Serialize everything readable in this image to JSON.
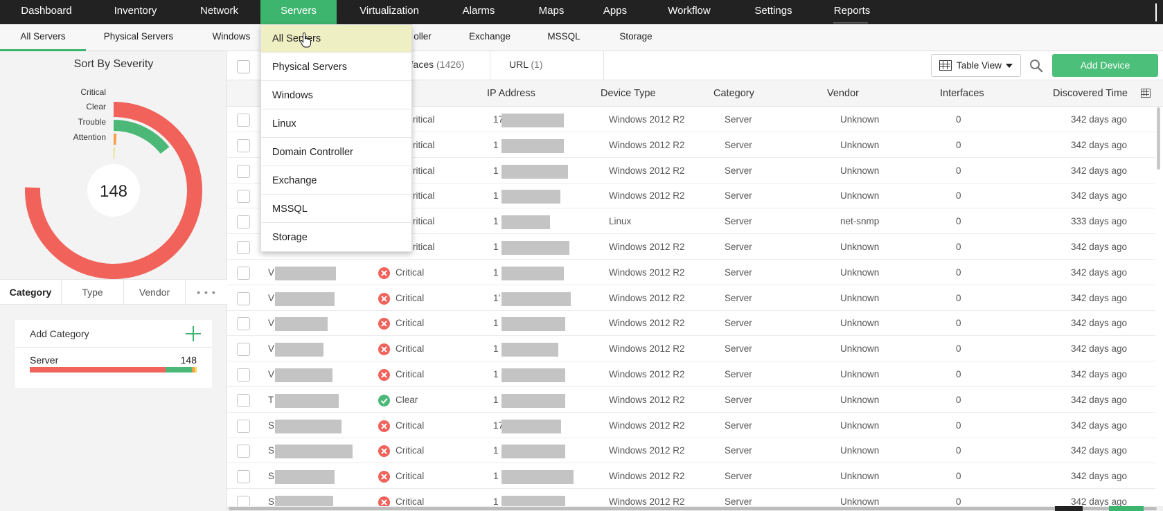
{
  "topnav": {
    "items": [
      {
        "label": "Dashboard"
      },
      {
        "label": "Inventory"
      },
      {
        "label": "Network"
      },
      {
        "label": "Servers"
      },
      {
        "label": "Virtualization"
      },
      {
        "label": "Alarms"
      },
      {
        "label": "Maps"
      },
      {
        "label": "Apps"
      },
      {
        "label": "Workflow"
      },
      {
        "label": "Settings"
      },
      {
        "label": "Reports"
      }
    ],
    "active": "Servers"
  },
  "subnav": {
    "items": [
      {
        "label": "All Servers"
      },
      {
        "label": "Physical Servers"
      },
      {
        "label": "Windows"
      },
      {
        "label": "oller"
      },
      {
        "label": "Exchange"
      },
      {
        "label": "MSSQL"
      },
      {
        "label": "Storage"
      }
    ],
    "active": "All Servers"
  },
  "dropdown": {
    "items": [
      {
        "label": "All Servers"
      },
      {
        "label": "Physical Servers"
      },
      {
        "label": "Windows"
      },
      {
        "label": "Linux"
      },
      {
        "label": "Domain Controller"
      },
      {
        "label": "Exchange"
      },
      {
        "label": "MSSQL"
      },
      {
        "label": "Storage"
      }
    ],
    "highlighted": "All Servers"
  },
  "severity": {
    "title": "Sort By Severity",
    "total": "148",
    "legend": [
      {
        "label": "Critical",
        "color": "#f0625a"
      },
      {
        "label": "Clear",
        "color": "#4cb878"
      },
      {
        "label": "Trouble",
        "color": "#f5a048"
      },
      {
        "label": "Attention",
        "color": "#e4e063"
      }
    ]
  },
  "filter_tabs": {
    "items": [
      {
        "label": "Category"
      },
      {
        "label": "Type"
      },
      {
        "label": "Vendor"
      }
    ],
    "more": "• • •",
    "active": "Category"
  },
  "category_box": {
    "add_label": "Add Category",
    "items": [
      {
        "name": "Server",
        "count": "148"
      }
    ]
  },
  "toolbar": {
    "tabs": [
      {
        "label": "rfaces",
        "count": "(1426)"
      },
      {
        "label": "URL",
        "count": "(1)"
      }
    ],
    "view_label": "Table View",
    "add_device_label": "Add Device"
  },
  "table": {
    "columns": [
      "IP Address",
      "Device Type",
      "Category",
      "Vendor",
      "Interfaces",
      "Discovered Time"
    ],
    "rows": [
      {
        "name_initial": "",
        "status": "Critical",
        "status_text": "ritical",
        "ip_prefix": "17",
        "device_type": "Windows 2012 R2",
        "category": "Server",
        "vendor": "Unknown",
        "interfaces": "0",
        "discovered": "342 days ago"
      },
      {
        "name_initial": "",
        "status": "Critical",
        "status_text": "ritical",
        "ip_prefix": "1",
        "device_type": "Windows 2012 R2",
        "category": "Server",
        "vendor": "Unknown",
        "interfaces": "0",
        "discovered": "342 days ago"
      },
      {
        "name_initial": "",
        "status": "Critical",
        "status_text": "ritical",
        "ip_prefix": "1",
        "device_type": "Windows 2012 R2",
        "category": "Server",
        "vendor": "Unknown",
        "interfaces": "0",
        "discovered": "342 days ago"
      },
      {
        "name_initial": "",
        "status": "Critical",
        "status_text": "ritical",
        "ip_prefix": "1",
        "device_type": "Windows 2012 R2",
        "category": "Server",
        "vendor": "Unknown",
        "interfaces": "0",
        "discovered": "342 days ago"
      },
      {
        "name_initial": "",
        "status": "Critical",
        "status_text": "ritical",
        "ip_prefix": "1",
        "device_type": "Linux",
        "category": "Server",
        "vendor": "net-snmp",
        "interfaces": "0",
        "discovered": "333 days ago"
      },
      {
        "name_initial": "",
        "status": "Critical",
        "status_text": "ritical",
        "ip_prefix": "1",
        "device_type": "Windows 2012 R2",
        "category": "Server",
        "vendor": "Unknown",
        "interfaces": "0",
        "discovered": "342 days ago"
      },
      {
        "name_initial": "V",
        "status": "Critical",
        "status_text": "Critical",
        "ip_prefix": "1",
        "device_type": "Windows 2012 R2",
        "category": "Server",
        "vendor": "Unknown",
        "interfaces": "0",
        "discovered": "342 days ago"
      },
      {
        "name_initial": "V",
        "status": "Critical",
        "status_text": "Critical",
        "ip_prefix": "1’",
        "device_type": "Windows 2012 R2",
        "category": "Server",
        "vendor": "Unknown",
        "interfaces": "0",
        "discovered": "342 days ago"
      },
      {
        "name_initial": "V",
        "status": "Critical",
        "status_text": "Critical",
        "ip_prefix": "1",
        "device_type": "Windows 2012 R2",
        "category": "Server",
        "vendor": "Unknown",
        "interfaces": "0",
        "discovered": "342 days ago"
      },
      {
        "name_initial": "V",
        "status": "Critical",
        "status_text": "Critical",
        "ip_prefix": "1",
        "device_type": "Windows 2012 R2",
        "category": "Server",
        "vendor": "Unknown",
        "interfaces": "0",
        "discovered": "342 days ago"
      },
      {
        "name_initial": "V",
        "status": "Critical",
        "status_text": "Critical",
        "ip_prefix": "1",
        "device_type": "Windows 2012 R2",
        "category": "Server",
        "vendor": "Unknown",
        "interfaces": "0",
        "discovered": "342 days ago"
      },
      {
        "name_initial": "T",
        "status": "Clear",
        "status_text": "Clear",
        "ip_prefix": "1",
        "device_type": "Windows 2012 R2",
        "category": "Server",
        "vendor": "Unknown",
        "interfaces": "0",
        "discovered": "342 days ago"
      },
      {
        "name_initial": "S",
        "status": "Critical",
        "status_text": "Critical",
        "ip_prefix": "17",
        "device_type": "Windows 2012 R2",
        "category": "Server",
        "vendor": "Unknown",
        "interfaces": "0",
        "discovered": "342 days ago"
      },
      {
        "name_initial": "S",
        "status": "Critical",
        "status_text": "Critical",
        "ip_prefix": "1",
        "device_type": "Windows 2012 R2",
        "category": "Server",
        "vendor": "Unknown",
        "interfaces": "0",
        "discovered": "342 days ago"
      },
      {
        "name_initial": "S",
        "status": "Critical",
        "status_text": "Critical",
        "ip_prefix": "1",
        "device_type": "Windows 2012 R2",
        "category": "Server",
        "vendor": "Unknown",
        "interfaces": "0",
        "discovered": "342 days ago"
      },
      {
        "name_initial": "S",
        "status": "Critical",
        "status_text": "Critical",
        "ip_prefix": "1",
        "device_type": "Windows 2012 R2",
        "category": "Server",
        "vendor": "Unknown",
        "interfaces": "0",
        "discovered": "342 days ago"
      }
    ]
  },
  "colors": {
    "accent": "#3db56e",
    "critical": "#f0625a",
    "clear": "#4cb878",
    "nav_bg": "#222222"
  }
}
